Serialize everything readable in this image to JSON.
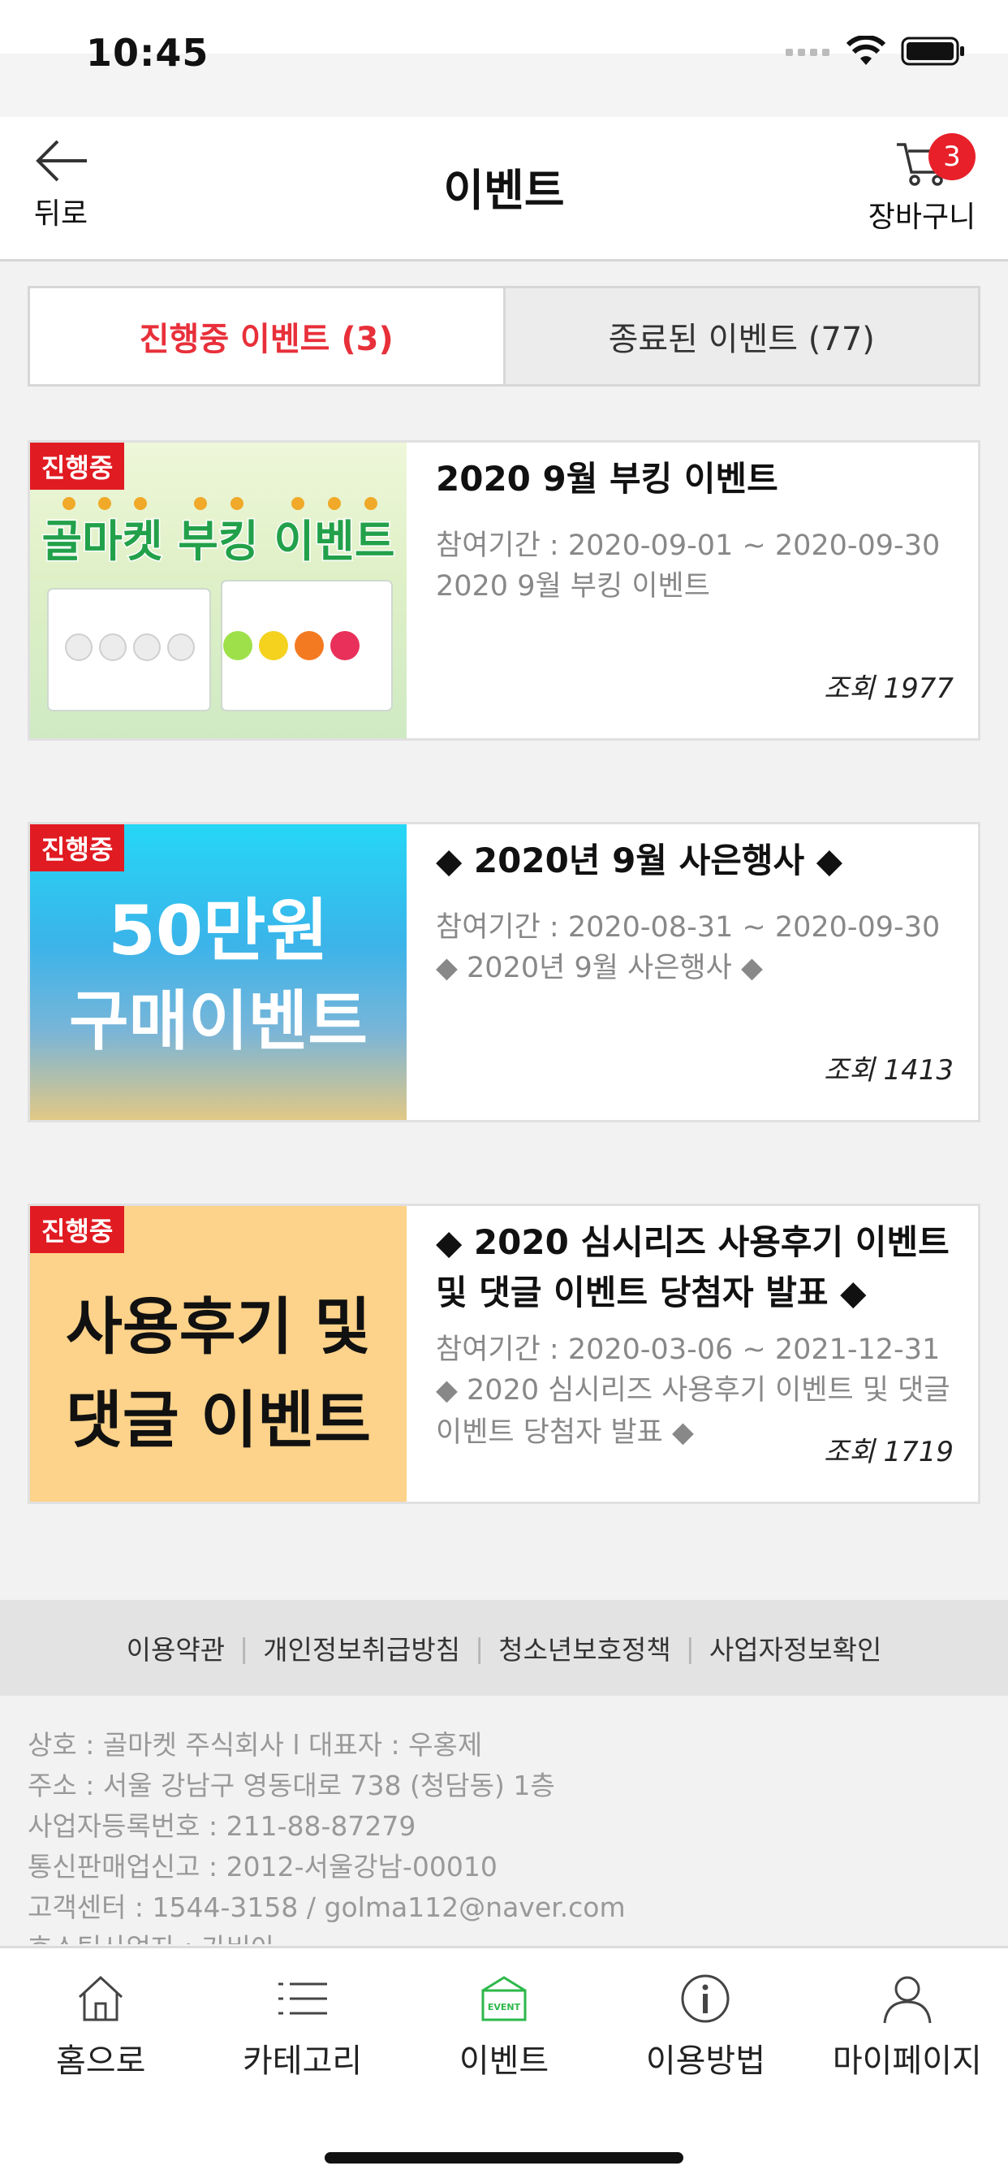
{
  "status": {
    "time": "10:45"
  },
  "header": {
    "back_label": "뒤로",
    "title": "이벤트",
    "cart_label": "장바구니",
    "cart_count": "3"
  },
  "tabs": [
    {
      "label": "진행중 이벤트 (3)",
      "active": true
    },
    {
      "label": "종료된 이벤트 (77)",
      "active": false
    }
  ],
  "events": [
    {
      "badge": "진행중",
      "thumb_text": [
        "골마켓 부킹 이벤트"
      ],
      "title": "2020 9월 부킹 이벤트",
      "period": "참여기간 : 2020-09-01 ~ 2020-09-30",
      "description": "2020 9월 부킹 이벤트",
      "views": "조회 1977"
    },
    {
      "badge": "진행중",
      "thumb_text": [
        "50만원",
        "구매이벤트"
      ],
      "title": "◆ 2020년 9월 사은행사 ◆",
      "period": "참여기간 : 2020-08-31 ~ 2020-09-30",
      "description": "◆ 2020년 9월 사은행사 ◆",
      "views": "조회 1413"
    },
    {
      "badge": "진행중",
      "thumb_text": [
        "사용후기 및",
        "댓글 이벤트"
      ],
      "title": "◆ 2020 심시리즈 사용후기 이벤트 및 댓글 이벤트 당첨자 발표 ◆",
      "period": "참여기간 : 2020-03-06 ~ 2021-12-31",
      "description": "◆ 2020 심시리즈 사용후기 이벤트 및 댓글 이벤트 당첨자 발표 ◆",
      "views": "조회 1719"
    }
  ],
  "footer": {
    "links": [
      "이용약관",
      "개인정보취급방침",
      "청소년보호정책",
      "사업자정보확인"
    ],
    "info": [
      "상호 : 골마켓 주식회사 l 대표자 : 우홍제",
      "주소 : 서울 강남구 영동대로 738 (청담동) 1층",
      "사업자등록번호 : 211-88-87279",
      "통신판매업신고 : 2012-서울강남-00010",
      "고객센터 : 1544-3158 / golma112@naver.com",
      "호스팅사업자 : 가비아"
    ]
  },
  "tabbar": [
    {
      "label": "홈으로",
      "icon": "home-icon"
    },
    {
      "label": "카테고리",
      "icon": "list-icon"
    },
    {
      "label": "이벤트",
      "icon": "event-icon",
      "active_color": "#2db84a"
    },
    {
      "label": "이용방법",
      "icon": "info-icon"
    },
    {
      "label": "마이페이지",
      "icon": "user-icon"
    }
  ],
  "colors": {
    "accent": "#e8303a",
    "badge": "#e11b22",
    "event_icon": "#2db84a"
  }
}
